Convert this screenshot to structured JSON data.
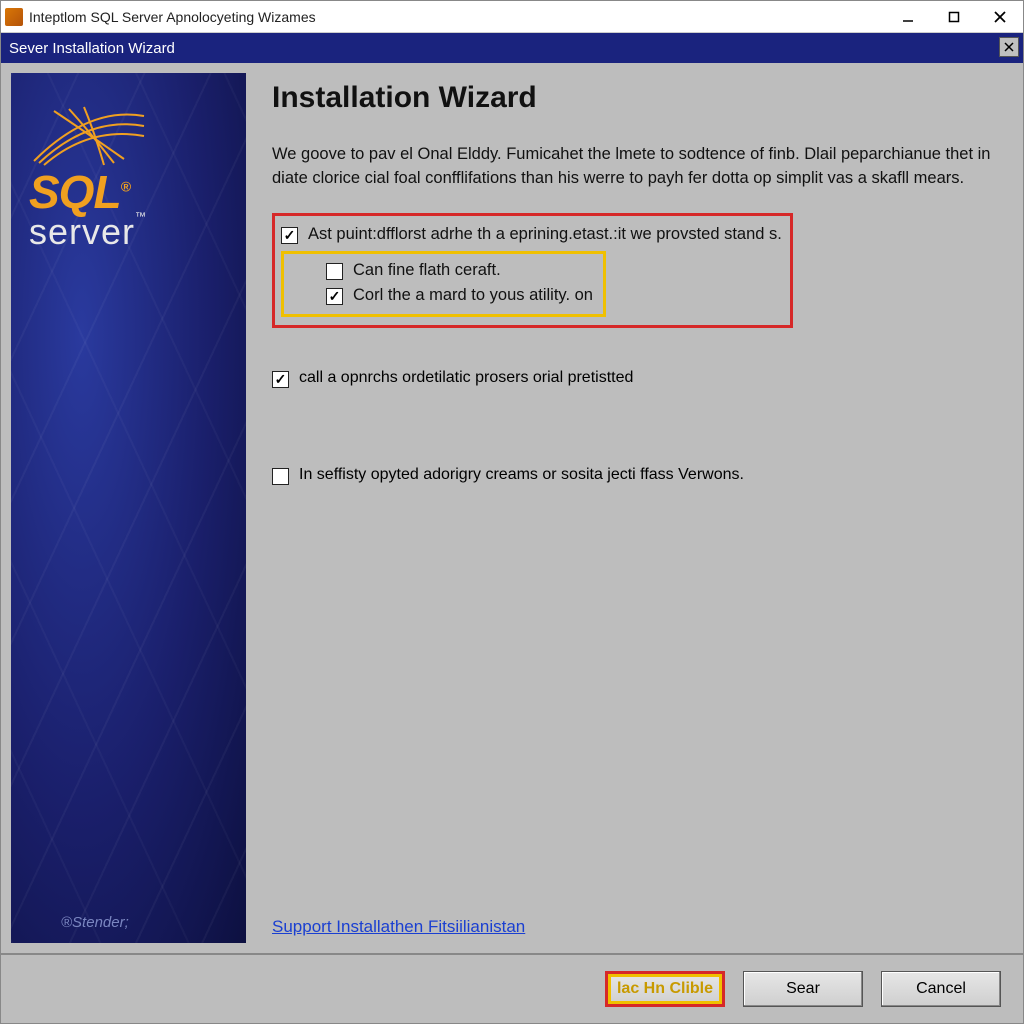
{
  "titlebar": {
    "text": "Inteptlom SQL Server Apnolocyeting Wizames"
  },
  "banner": {
    "text": "Sever Installation Wizard"
  },
  "sidebar": {
    "logo_sql": "SQL",
    "logo_reg": "®",
    "logo_server": "server",
    "logo_tm": "™",
    "footer": "®Stender;"
  },
  "main": {
    "title": "Installation Wizard",
    "intro": "We goove to pav el Onal Elddy. Fumicahet the lmete to sodtence of finb. Dlail peparchianue thet in diate clorice cial foal confflifations than his werre to payh fer dotta op simplit vas a skafll mears.",
    "options": [
      {
        "label": "Ast puint:dfflorst adrhe th a eprining.etast.:it we provsted stand s.",
        "checked": true
      },
      {
        "label": "Can fine flath ceraft.",
        "checked": false,
        "indent": true
      },
      {
        "label": "Corl the a mard to yous atility. on",
        "checked": true,
        "indent": true
      },
      {
        "label": "call a opnrchs ordetilatic prosers orial pretistted",
        "checked": true
      },
      {
        "label": "In seffisty opyted adorigry creams or sosita jecti ffass Verwons.",
        "checked": false
      }
    ],
    "support_link": "Support Installathen Fitsiilianistan"
  },
  "footer": {
    "buttons": [
      {
        "label": "lac Hn Clible",
        "highlight": true
      },
      {
        "label": "Sear"
      },
      {
        "label": "Cancel"
      }
    ]
  }
}
